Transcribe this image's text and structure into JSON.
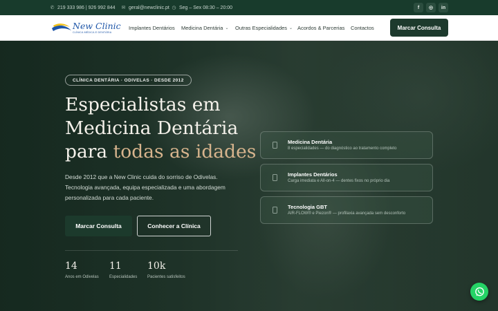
{
  "topbar": {
    "phone": "219 333 986  |  926 992 844",
    "email": "geral@newclinic.pt",
    "hours": "Seg – Sex  08:30 – 20:00",
    "social": [
      {
        "icon": "facebook-icon",
        "label": "f"
      },
      {
        "icon": "instagram-icon",
        "label": "◎"
      },
      {
        "icon": "linkedin-icon",
        "label": "in"
      }
    ]
  },
  "brand": {
    "name": "New Clinic",
    "tagline": "CLÍNICA MÉDICA E DENTÁRIA",
    "colors": {
      "primary": "#1d3a2d",
      "accent": "#d7b48d",
      "logo_blue": "#1e56a8",
      "logo_yellow": "#f2c21b"
    }
  },
  "nav": {
    "items": [
      {
        "label": "Implantes Dentários",
        "dropdown": false
      },
      {
        "label": "Medicina Dentária",
        "dropdown": true
      },
      {
        "label": "Outras Especialidades",
        "dropdown": true
      },
      {
        "label": "Acordos & Parcerias",
        "dropdown": false
      },
      {
        "label": "Contactos",
        "dropdown": false
      }
    ],
    "cta": "Marcar Consulta"
  },
  "hero": {
    "badge": "CLÍNICA DENTÁRIA · ODIVELAS · DESDE 2012",
    "headline_line1": "Especialistas em",
    "headline_line2": "Medicina Dentária",
    "headline_line3_plain": "para ",
    "headline_line3_accent": "todas as idades",
    "description": "Desde 2012 que a New Clinic cuida do sorriso de Odivelas. Tecnologia avançada, equipa especializada e uma abordagem personalizada para cada paciente.",
    "btn_primary": "Marcar Consulta",
    "btn_secondary": "Conhecer a Clínica",
    "stats": [
      {
        "value": "14",
        "label": "Anos em Odivelas"
      },
      {
        "value": "11",
        "label": "Especialidades"
      },
      {
        "value": "10k",
        "label": "Pacientes satisfeitos"
      }
    ],
    "cards": [
      {
        "title": "Medicina Dentária",
        "subtitle": "8 especialidades — do diagnóstico ao tratamento completo"
      },
      {
        "title": "Implantes Dentários",
        "subtitle": "Carga imediata e All-on-4 — dentes fixos no próprio dia"
      },
      {
        "title": "Tecnologia GBT",
        "subtitle": "AIR-FLOW® e Piezon® — profilaxia avançada sem desconforto"
      }
    ]
  },
  "whatsapp": {
    "icon": "whatsapp-icon"
  }
}
